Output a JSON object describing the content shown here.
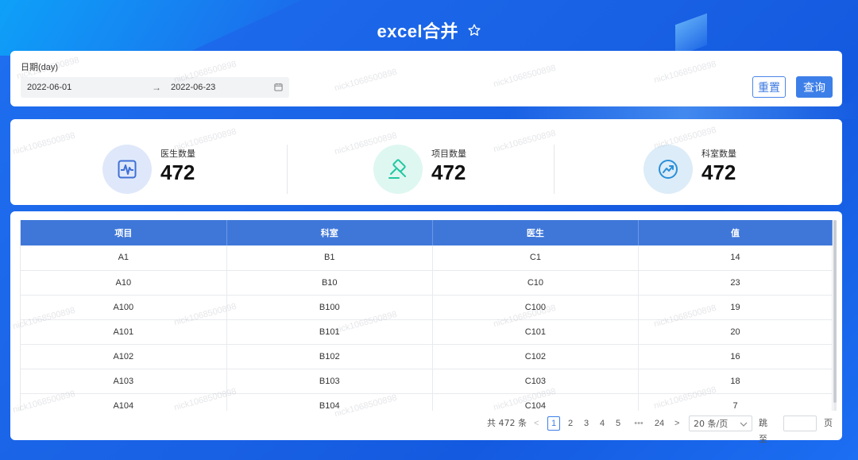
{
  "header": {
    "title": "excel合并",
    "star_icon": "star-outline-icon"
  },
  "filter": {
    "date_label": "日期(day)",
    "start_date": "2022-06-01",
    "separator": "→",
    "end_date": "2022-06-23",
    "calendar_icon": "calendar-icon",
    "reset_label": "重置",
    "query_label": "查询"
  },
  "stats": [
    {
      "label": "医生数量",
      "value": "472",
      "icon": "activity-chart-icon",
      "color": "#3f6fd6",
      "bg": "#dfe8fa"
    },
    {
      "label": "项目数量",
      "value": "472",
      "icon": "gavel-icon",
      "color": "#1fc7a0",
      "bg": "#dff7f1"
    },
    {
      "label": "科室数量",
      "value": "472",
      "icon": "trend-up-icon",
      "color": "#2a8fd8",
      "bg": "#dcecf8"
    }
  ],
  "table": {
    "columns": [
      "项目",
      "科室",
      "医生",
      "值"
    ],
    "rows": [
      [
        "A1",
        "B1",
        "C1",
        "14"
      ],
      [
        "A10",
        "B10",
        "C10",
        "23"
      ],
      [
        "A100",
        "B100",
        "C100",
        "19"
      ],
      [
        "A101",
        "B101",
        "C101",
        "20"
      ],
      [
        "A102",
        "B102",
        "C102",
        "16"
      ],
      [
        "A103",
        "B103",
        "C103",
        "18"
      ],
      [
        "A104",
        "B104",
        "C104",
        "7"
      ]
    ]
  },
  "pagination": {
    "total": "共 472 条",
    "prev": "<",
    "pages": [
      "1",
      "2",
      "3",
      "4",
      "5"
    ],
    "ellipsis": "•••",
    "last_page": "24",
    "next": ">",
    "page_size": "20 条/页",
    "jump_label": "跳至",
    "page_unit": "页"
  },
  "watermark": "nick1068500898",
  "colors": {
    "primary": "#3d7fe9",
    "header_bg": "#3f77d9"
  }
}
